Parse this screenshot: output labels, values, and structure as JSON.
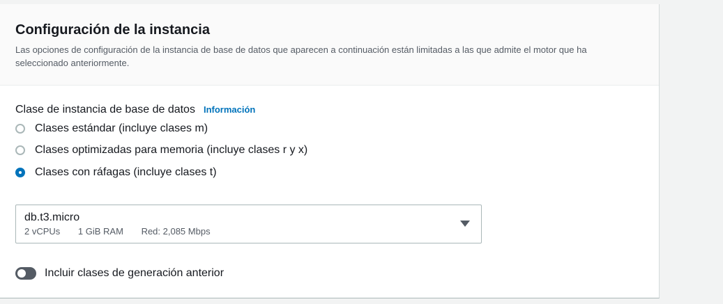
{
  "section": {
    "title": "Configuración de la instancia",
    "description": "Las opciones de configuración de la instancia de base de datos que aparecen a continuación están limitadas a las que admite el motor que ha seleccionado anteriormente."
  },
  "instance_class": {
    "label": "Clase de instancia de base de datos",
    "info_link": "Información",
    "options": [
      {
        "label": "Clases estándar (incluye clases m)",
        "checked": false
      },
      {
        "label": "Clases optimizadas para memoria (incluye clases r y x)",
        "checked": false
      },
      {
        "label": "Clases con ráfagas (incluye clases t)",
        "checked": true
      }
    ]
  },
  "select": {
    "value": "db.t3.micro",
    "vcpus": "2 vCPUs",
    "ram": "1 GiB RAM",
    "network": "Red: 2,085 Mbps"
  },
  "toggle": {
    "label": "Incluir clases de generación anterior",
    "on": false
  }
}
